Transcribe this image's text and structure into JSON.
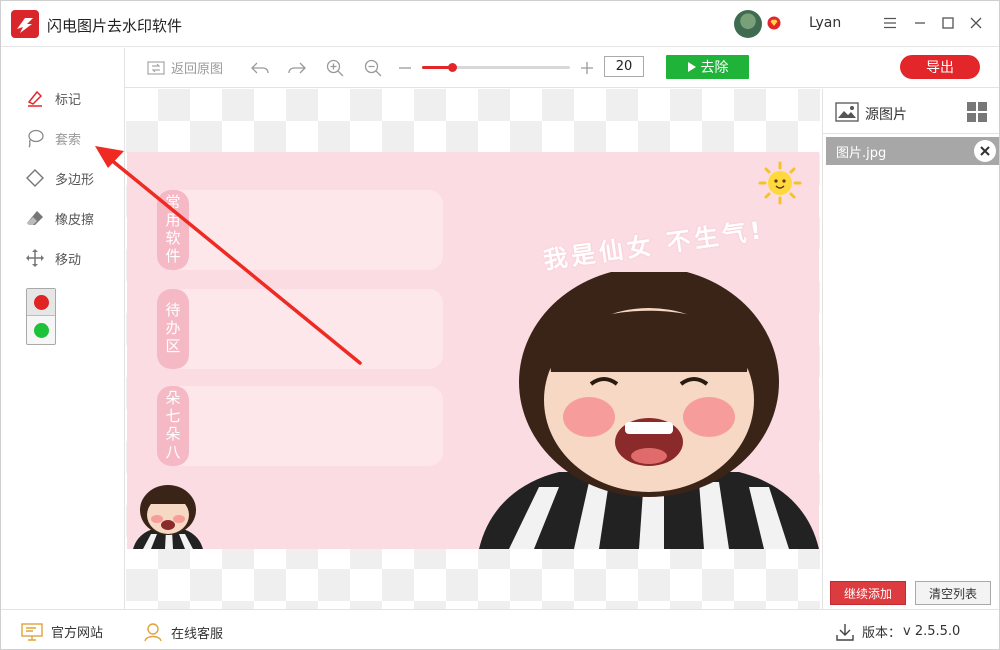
{
  "app": {
    "title": "闪电图片去水印软件",
    "user_name": "Lyan"
  },
  "toolbar": {
    "restore_label": "返回原图",
    "zoom_value": "20",
    "zoom_fraction": 0.2,
    "remove_label": "去除",
    "export_label": "导出"
  },
  "tools": [
    {
      "label": "标记",
      "icon": "marker-icon"
    },
    {
      "label": "套索",
      "icon": "lasso-icon"
    },
    {
      "label": "多边形",
      "icon": "polygon-icon"
    },
    {
      "label": "橡皮擦",
      "icon": "eraser-icon"
    },
    {
      "label": "移动",
      "icon": "move-icon"
    }
  ],
  "colors": {
    "top": "#e02424",
    "bottom": "#1ec23a",
    "accent_red": "#e2262a",
    "accent_green": "#1fb33a"
  },
  "image": {
    "cards": [
      "常用软件",
      "待办区",
      "朵七朵八"
    ],
    "slogan": "我是仙女 不生气!"
  },
  "right_panel": {
    "title": "源图片",
    "files": [
      "图片.jpg"
    ],
    "add_label": "继续添加",
    "clear_label": "清空列表"
  },
  "status": {
    "website": "官方网站",
    "support": "在线客服",
    "version_label": "版本：",
    "version": "v 2.5.5.0"
  }
}
